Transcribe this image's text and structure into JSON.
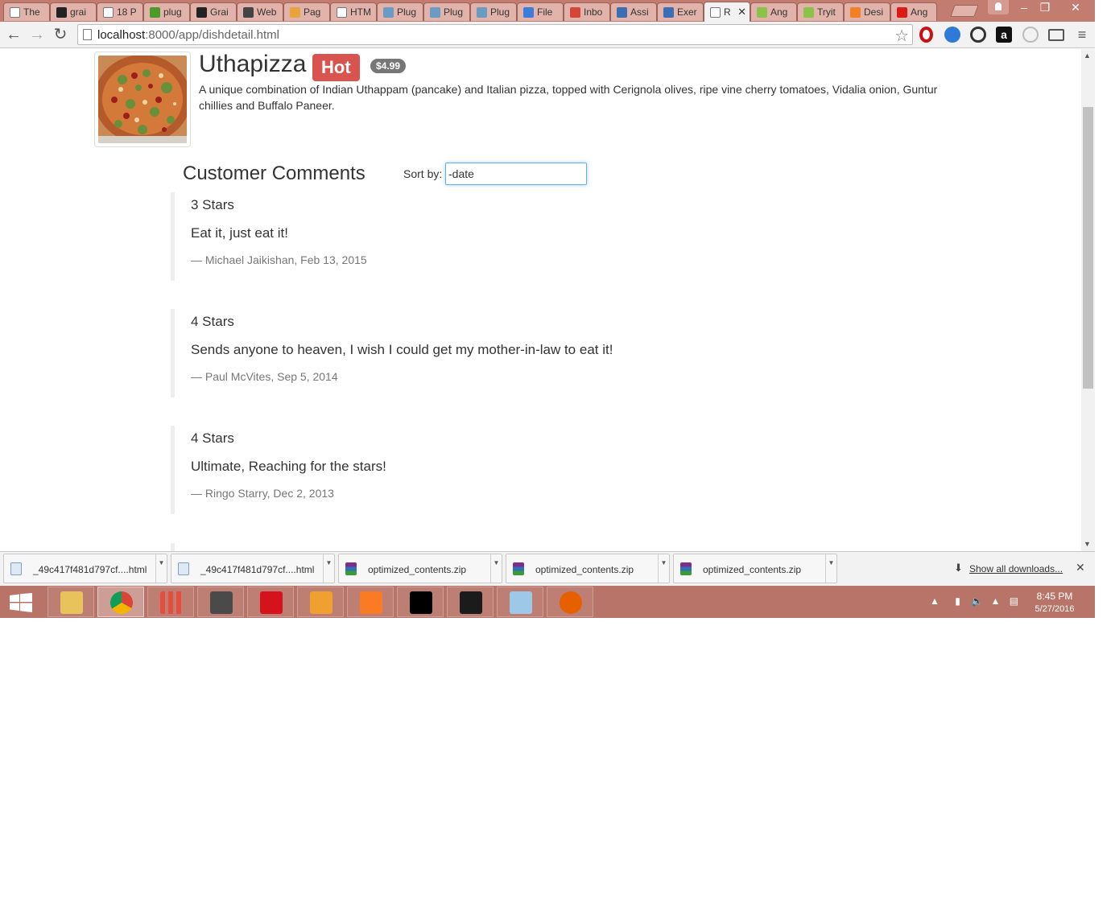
{
  "browser": {
    "tabs": [
      {
        "title": "The",
        "icon": "page-icon",
        "color": "#ffffff"
      },
      {
        "title": "grai",
        "icon": "github-icon",
        "color": "#222222"
      },
      {
        "title": "18 P",
        "icon": "page-icon",
        "color": "#ffffff"
      },
      {
        "title": "plug",
        "icon": "download-icon",
        "color": "#4c9a2a"
      },
      {
        "title": "Grai",
        "icon": "github-icon",
        "color": "#222222"
      },
      {
        "title": "Web",
        "icon": "p-icon",
        "color": "#444444"
      },
      {
        "title": "Pag",
        "icon": "dots-icon",
        "color": "#e8a33c"
      },
      {
        "title": "HTM",
        "icon": "page-icon",
        "color": "#ffffff"
      },
      {
        "title": "Plug",
        "icon": "globe-icon",
        "color": "#6a9bc3"
      },
      {
        "title": "Plug",
        "icon": "globe-icon",
        "color": "#6a9bc3"
      },
      {
        "title": "Plug",
        "icon": "globe-icon",
        "color": "#6a9bc3"
      },
      {
        "title": "File",
        "icon": "file-icon",
        "color": "#3b7dd8"
      },
      {
        "title": "Inbo",
        "icon": "gmail-icon",
        "color": "#d44638"
      },
      {
        "title": "Assi",
        "icon": "link-icon",
        "color": "#3c6eb4"
      },
      {
        "title": "Exer",
        "icon": "link-icon",
        "color": "#3c6eb4"
      },
      {
        "title": "R",
        "icon": "page-icon",
        "color": "#ffffff",
        "active": true
      },
      {
        "title": "Ang",
        "icon": "plunker-icon",
        "color": "#8bc34a"
      },
      {
        "title": "Tryit",
        "icon": "plunker-icon",
        "color": "#8bc34a"
      },
      {
        "title": "Desi",
        "icon": "stackoverflow-icon",
        "color": "#f48024"
      },
      {
        "title": "Ang",
        "icon": "angular-icon",
        "color": "#dd1b16"
      }
    ],
    "url_host": "localhost",
    "url_path": ":8000/app/dishdetail.html"
  },
  "dish": {
    "name": "Uthapizza",
    "label": "Hot",
    "price": "$4.99",
    "description": "A unique combination of Indian Uthappam (pancake) and Italian pizza, topped with Cerignola olives, ripe vine cherry tomatoes, Vidalia onion, Guntur chillies and Buffalo Paneer."
  },
  "comments_section": {
    "title": "Customer Comments",
    "sort_label": "Sort by:",
    "sort_value": "-date"
  },
  "comments": [
    {
      "rating": "3 Stars",
      "text": "Eat it, just eat it!",
      "footer": "— Michael Jaikishan, Feb 13, 2015"
    },
    {
      "rating": "4 Stars",
      "text": "Sends anyone to heaven, I wish I could get my mother-in-law to eat it!",
      "footer": "— Paul McVites, Sep 5, 2014"
    },
    {
      "rating": "4 Stars",
      "text": "Ultimate, Reaching for the stars!",
      "footer": "— Ringo Starry, Dec 2, 2013"
    }
  ],
  "downloads": {
    "items": [
      {
        "name": "_49c417f481d797cf....html",
        "icon": "html-file-icon"
      },
      {
        "name": "_49c417f481d797cf....html",
        "icon": "html-file-icon"
      },
      {
        "name": "optimized_contents.zip",
        "icon": "winrar-icon"
      },
      {
        "name": "optimized_contents.zip",
        "icon": "winrar-icon"
      },
      {
        "name": "optimized_contents.zip",
        "icon": "winrar-icon"
      }
    ],
    "show_all": "Show all downloads..."
  },
  "taskbar": {
    "apps": [
      {
        "name": "file-explorer-icon",
        "color": "#e8c25a"
      },
      {
        "name": "chrome-icon",
        "color": "#4285f4",
        "active": true
      },
      {
        "name": "apps-grid-icon",
        "color": "#ffffff"
      },
      {
        "name": "sublime-icon",
        "color": "#4a4a4a"
      },
      {
        "name": "acrobat-icon",
        "color": "#d4141a"
      },
      {
        "name": "paint-icon",
        "color": "#f0a030"
      },
      {
        "name": "xampp-icon",
        "color": "#fb7a24"
      },
      {
        "name": "cmd-icon",
        "color": "#000000"
      },
      {
        "name": "intellij-icon",
        "color": "#1b1b1b"
      },
      {
        "name": "notepad-icon",
        "color": "#9ec8e8"
      },
      {
        "name": "firefox-icon",
        "color": "#e66000"
      }
    ],
    "time": "8:45 PM",
    "date": "5/27/2016"
  }
}
